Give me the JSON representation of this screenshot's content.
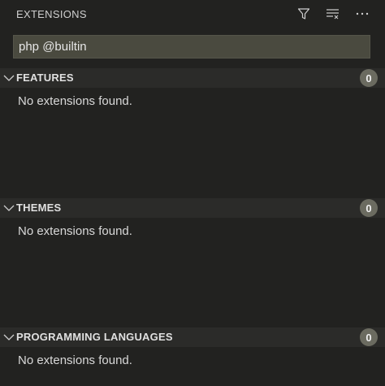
{
  "header": {
    "title": "EXTENSIONS",
    "actions": [
      {
        "name": "filter-icon"
      },
      {
        "name": "clear-results-icon"
      },
      {
        "name": "more-actions-icon"
      }
    ]
  },
  "search": {
    "value": "php @builtin",
    "placeholder": ""
  },
  "sections": [
    {
      "title": "FEATURES",
      "count": "0",
      "empty_text": "No extensions found."
    },
    {
      "title": "THEMES",
      "count": "0",
      "empty_text": "No extensions found."
    },
    {
      "title": "PROGRAMMING LANGUAGES",
      "count": "0",
      "empty_text": "No extensions found."
    }
  ],
  "colors": {
    "background": "#222220",
    "section_header": "#2b2b29",
    "search_bg": "#4a4a3f",
    "badge_bg": "#6b6b60"
  }
}
